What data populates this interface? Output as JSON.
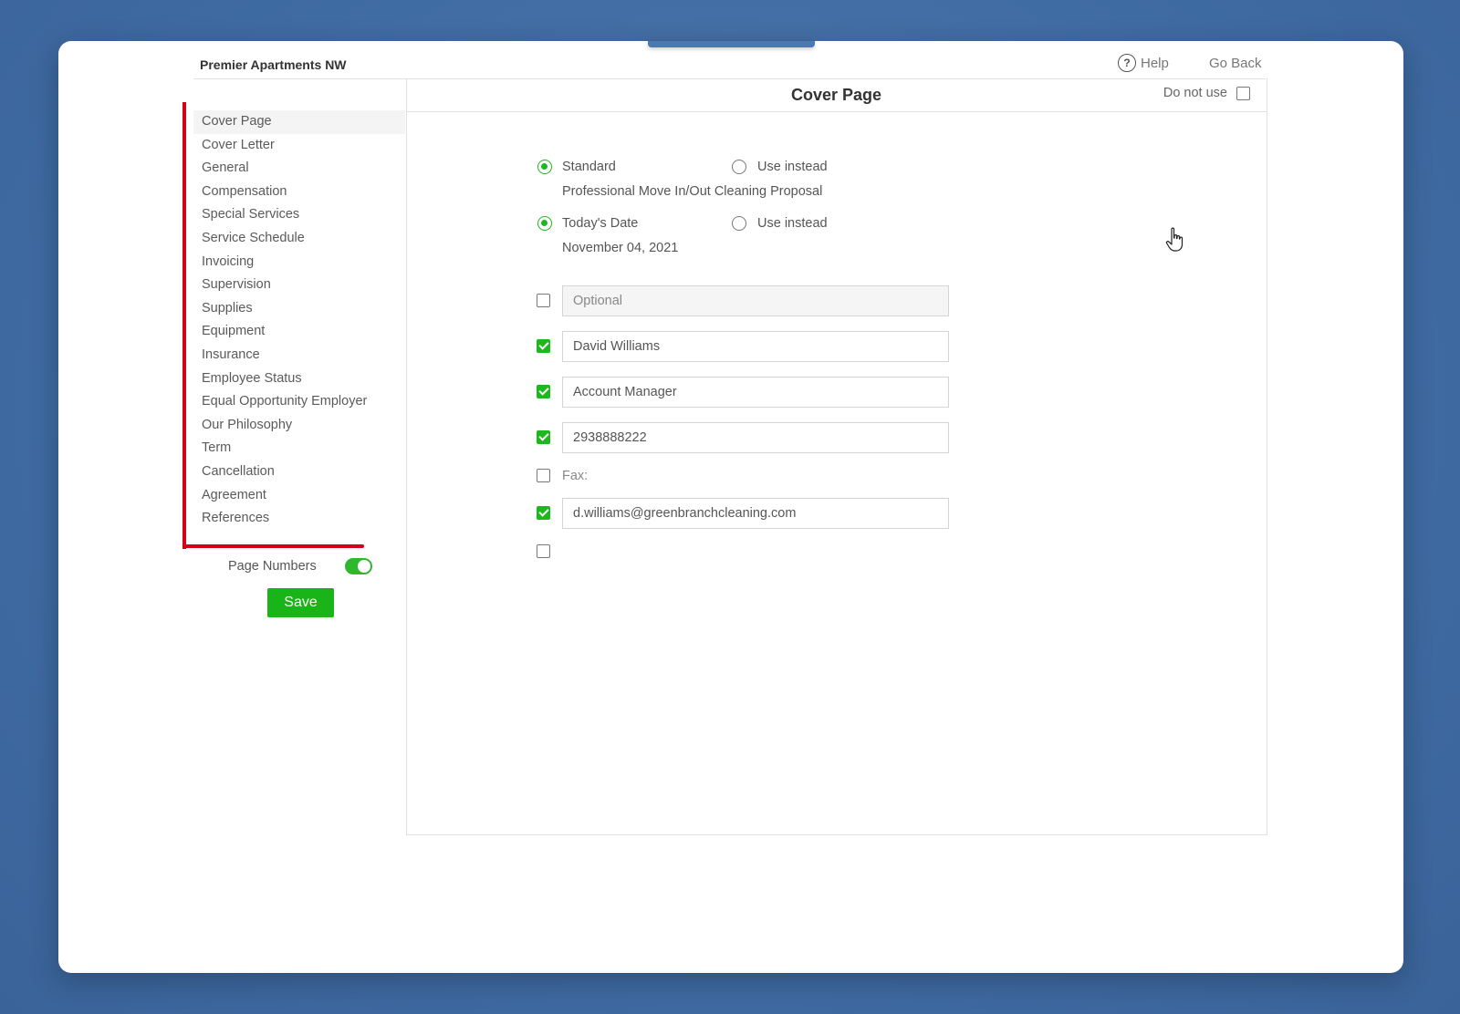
{
  "header": {
    "brand": "Premier Apartments NW",
    "help_label": "Help",
    "goback_label": "Go Back"
  },
  "sidebar": {
    "items": [
      {
        "label": "Cover Page",
        "active": true
      },
      {
        "label": "Cover Letter"
      },
      {
        "label": "General"
      },
      {
        "label": "Compensation"
      },
      {
        "label": "Special Services"
      },
      {
        "label": "Service Schedule"
      },
      {
        "label": "Invoicing"
      },
      {
        "label": "Supervision"
      },
      {
        "label": "Supplies"
      },
      {
        "label": "Equipment"
      },
      {
        "label": "Insurance"
      },
      {
        "label": "Employee Status"
      },
      {
        "label": "Equal Opportunity Employer"
      },
      {
        "label": "Our Philosophy"
      },
      {
        "label": "Term"
      },
      {
        "label": "Cancellation"
      },
      {
        "label": "Agreement"
      },
      {
        "label": "References"
      }
    ],
    "page_numbers_label": "Page Numbers",
    "page_numbers_on": true,
    "save_label": "Save"
  },
  "panel": {
    "title": "Cover Page",
    "do_not_use_label": "Do not use",
    "do_not_use_checked": false,
    "title_option": {
      "standard_label": "Standard",
      "use_instead_label": "Use instead",
      "standard_value": "Professional Move In/Out Cleaning Proposal",
      "selected": "standard"
    },
    "date_option": {
      "todays_date_label": "Today's Date",
      "use_instead_label": "Use instead",
      "date_value": "November 04, 2021",
      "selected": "todays_date"
    },
    "fields": [
      {
        "checked": false,
        "value": "",
        "placeholder": "Optional"
      },
      {
        "checked": true,
        "value": "David Williams",
        "placeholder": ""
      },
      {
        "checked": true,
        "value": "Account Manager",
        "placeholder": ""
      },
      {
        "checked": true,
        "value": "2938888222",
        "placeholder": ""
      }
    ],
    "fax": {
      "checked": false,
      "label": "Fax:"
    },
    "email": {
      "checked": true,
      "value": "d.williams@greenbranchcleaning.com"
    },
    "extra_checkbox_checked": false
  },
  "colors": {
    "accent_green": "#1db81d",
    "sidebar_marker": "#d4001a",
    "background_blue": "#3f6ba3"
  }
}
